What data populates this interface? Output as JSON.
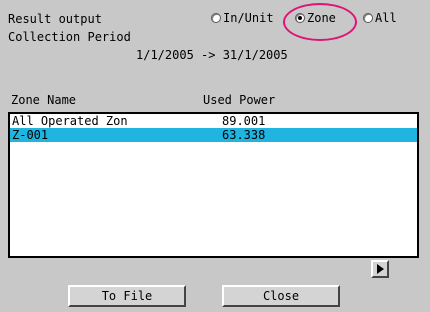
{
  "header": {
    "result_output_label": "Result output",
    "collection_period_label": "Collection Period",
    "period_range": "1/1/2005 -> 31/1/2005"
  },
  "radio_options": [
    {
      "label": "In/Unit",
      "checked": false
    },
    {
      "label": "Zone",
      "checked": true
    },
    {
      "label": "All",
      "checked": false
    }
  ],
  "table": {
    "columns": [
      "Zone Name",
      "Used Power"
    ],
    "rows": [
      {
        "name": "All Operated Zon",
        "power": "89.001",
        "selected": false
      },
      {
        "name": "Z-001",
        "power": "63.338",
        "selected": true
      }
    ]
  },
  "buttons": {
    "to_file": "To File",
    "close": "Close"
  },
  "colors": {
    "background": "#c8c8c8",
    "selection": "#1fb5e0",
    "highlight_ring": "#e0127a"
  },
  "icons": {
    "next": "play-right-arrow-icon"
  }
}
